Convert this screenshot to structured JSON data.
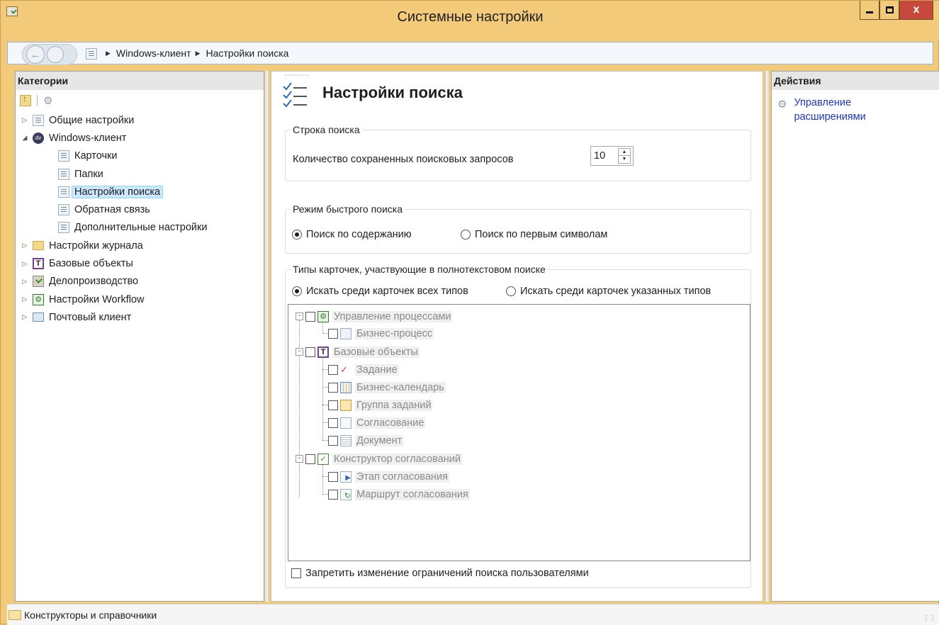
{
  "window": {
    "title": "Системные настройки",
    "controls": {
      "minimize": "_",
      "maximize": "□",
      "close": "x"
    }
  },
  "address": {
    "crumbs": [
      "Windows-клиент",
      "Настройки поиска"
    ]
  },
  "left": {
    "header": "Категории",
    "tree": [
      {
        "label": "Общие настройки",
        "icon": "list-icon",
        "expander": "▷"
      },
      {
        "label": "Windows-клиент",
        "icon": "dv-icon",
        "expander": "◢"
      },
      {
        "label": "Карточки",
        "icon": "list-icon"
      },
      {
        "label": "Папки",
        "icon": "list-icon"
      },
      {
        "label": "Настройки поиска",
        "icon": "list-icon",
        "selected": true
      },
      {
        "label": "Обратная связь",
        "icon": "list-icon"
      },
      {
        "label": "Дополнительные настройки",
        "icon": "list-icon"
      },
      {
        "label": "Настройки журнала",
        "icon": "folder-icon",
        "expander": "▷"
      },
      {
        "label": "Базовые объекты",
        "icon": "objects-icon",
        "expander": "▷"
      },
      {
        "label": "Делопроизводство",
        "icon": "docflow-icon",
        "expander": "▷"
      },
      {
        "label": "Настройки Workflow",
        "icon": "workflow-icon",
        "expander": "▷"
      },
      {
        "label": "Почтовый клиент",
        "icon": "mail-icon",
        "expander": "▷"
      }
    ]
  },
  "center": {
    "title": "Настройки поиска",
    "search_line": {
      "legend": "Строка поиска",
      "saved_queries_label": "Количество сохраненных поисковых запросов",
      "saved_queries_value": "10"
    },
    "quick_search": {
      "legend": "Режим быстрого поиска",
      "option_content": "Поиск по содержанию",
      "option_first": "Поиск по первым символам",
      "selected": "content"
    },
    "card_types": {
      "legend": "Типы карточек, участвующие в полнотекстовом поиске",
      "option_all": "Искать среди карточек всех типов",
      "option_specified": "Искать среди карточек указанных типов",
      "selected": "all",
      "tree": [
        {
          "label": "Управление процессами",
          "icon": "process-management-icon",
          "level": 0
        },
        {
          "label": "Бизнес-процесс",
          "icon": "business-process-icon",
          "level": 1
        },
        {
          "label": "Базовые объекты",
          "icon": "base-objects-icon",
          "level": 0
        },
        {
          "label": "Задание",
          "icon": "task-icon",
          "level": 1
        },
        {
          "label": "Бизнес-календарь",
          "icon": "calendar-icon",
          "level": 1
        },
        {
          "label": "Группа заданий",
          "icon": "task-group-icon",
          "level": 1
        },
        {
          "label": "Согласование",
          "icon": "approval-icon",
          "level": 1
        },
        {
          "label": "Документ",
          "icon": "document-icon",
          "level": 1
        },
        {
          "label": "Конструктор согласований",
          "icon": "approval-designer-icon",
          "level": 0
        },
        {
          "label": "Этап согласования",
          "icon": "approval-stage-icon",
          "level": 1
        },
        {
          "label": "Маршрут согласования",
          "icon": "approval-route-icon",
          "level": 1
        }
      ],
      "restrict_label": "Запретить изменение ограничений поиска пользователями"
    }
  },
  "right": {
    "header": "Действия",
    "actions": [
      "Управление расширениями"
    ]
  },
  "status": {
    "text": "Конструкторы и справочники"
  },
  "colors": {
    "frame": "#f2ca7a",
    "close": "#c7493e",
    "link": "#1a33e0",
    "selection": "#cce8ff"
  }
}
